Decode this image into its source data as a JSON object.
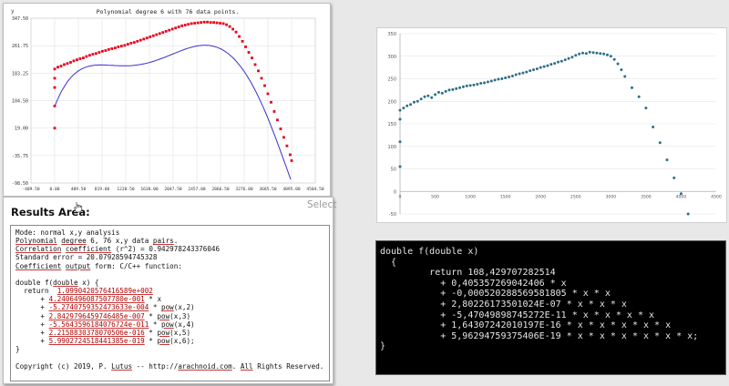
{
  "left_chart": {
    "title": "Polynomial degree 6 with 76 data points.",
    "y_axis_label": "y",
    "y_ticks": [
      "347.50",
      "261.75",
      "183.25",
      "104.50",
      "19.00",
      "-35.75",
      "-98.50"
    ],
    "x_ticks": [
      "-409.50",
      "0.00",
      "409.50",
      "819.00",
      "1228.50",
      "1638.00",
      "2047.50",
      "2457.00",
      "2866.50",
      "3276.00",
      "3685.50",
      "4095.00",
      "4504.50"
    ],
    "point_color": "#e8001c",
    "curve_color": "#3a2fd0"
  },
  "results": {
    "title": "Results Area:",
    "select_label": "Select",
    "lines": {
      "mode": "Mode: normal x,y analysis",
      "poly_a": "Polynomial",
      "poly_b": " ",
      "poly_c": "degree",
      "poly_d": " 6, 76 x,y data ",
      "poly_e": "pairs",
      "poly_f": ".",
      "corr_a": "Correlation",
      "corr_b": " ",
      "corr_c": "coefficient",
      "corr_d": " (r^2) = 0.942978243376046",
      "stderr": "Standard error = 20.07928594745328",
      "coef_a": "Coefficient",
      "coef_b": " ",
      "coef_c": "output",
      "coef_d": " form: C/C++ function:",
      "fn_a": "double f(",
      "fn_b": "double",
      "fn_c": " x) {",
      "ret": "  return  ",
      "c0": "1.0990420576416589e+002",
      "c1": "4.2406496087507780e-001",
      "c1s": " * x",
      "c2": "-5.2740759352473633e-004",
      "c3": "2.8429796459746485e-007",
      "c4": "-5.5643596184076724e-011",
      "c5": "2.2158830378070506e-016",
      "c6": "5.9902724518441385e-019",
      "pow": "pow",
      "p2": "(x,2)",
      "p3": "(x,3)",
      "p4": "(x,4)",
      "p5": "(x,5)",
      "p6": "(x,6);",
      "plus": "      + ",
      "star": " * ",
      "close": "}",
      "copy_a": "Copyright (c) 2019, P. ",
      "copy_b": "Lutus",
      "copy_c": " -- http://",
      "copy_d": "arachnoid.com",
      "copy_e": ". ",
      "copy_f": "All",
      "copy_g": " Rights Reserved."
    }
  },
  "right_chart": {
    "y_ticks": [
      "350",
      "300",
      "250",
      "200",
      "150",
      "100",
      "50",
      "0",
      "-50"
    ],
    "x_ticks": [
      "0",
      "500",
      "1000",
      "1500",
      "2000",
      "2500",
      "3000",
      "3500",
      "4000",
      "4500"
    ],
    "point_color": "#2f6f86"
  },
  "console": {
    "lines": [
      "double f(double x)",
      "  {",
      "         return 108,429707282514",
      "           + 0,405357269042406 * x",
      "           + -0,000520288569581805 * x * x",
      "           + 2,80226173501024E-07 * x * x * x",
      "           + -5,47049898745272E-11 * x * x * x * x",
      "           + 1,64307242010197E-16 * x * x * x * x * x",
      "           + 5,96294759375406E-19 * x * x * x * x * x * x;",
      "}"
    ]
  },
  "chart_data": [
    {
      "type": "scatter",
      "title": "Polynomial degree 6 with 76 data points.",
      "ylabel": "y",
      "xlim": [
        -409.5,
        4504.5
      ],
      "ylim": [
        -98.5,
        347.5
      ],
      "x": [
        0,
        0,
        0,
        0,
        0,
        55,
        110,
        165,
        220,
        275,
        330,
        385,
        440,
        495,
        550,
        605,
        660,
        715,
        770,
        825,
        880,
        935,
        990,
        1045,
        1100,
        1155,
        1210,
        1265,
        1320,
        1375,
        1430,
        1485,
        1540,
        1595,
        1650,
        1705,
        1760,
        1815,
        1870,
        1925,
        1980,
        2035,
        2090,
        2145,
        2200,
        2255,
        2310,
        2365,
        2420,
        2475,
        2530,
        2585,
        2640,
        2695,
        2750,
        2805,
        2860,
        2915,
        2970,
        3025,
        3080,
        3135,
        3190,
        3245,
        3300,
        3355,
        3410,
        3465,
        3520,
        3575,
        3630,
        3685,
        3740,
        3795,
        3850,
        3905,
        3960,
        4015,
        4070,
        4095
      ],
      "series": [
        {
          "values": [
            50,
            110,
            160,
            185,
            210,
            215,
            218,
            222,
            225,
            228,
            232,
            235,
            238,
            240,
            244,
            247,
            250,
            252,
            255,
            258,
            260,
            263,
            265,
            267,
            270,
            272,
            274,
            277,
            280,
            282,
            285,
            288,
            291,
            294,
            297,
            300,
            303,
            306,
            309,
            312,
            315,
            318,
            321,
            324,
            327,
            329,
            331,
            333,
            334,
            335,
            336,
            337,
            337,
            336,
            336,
            335,
            334,
            333,
            330,
            325,
            318,
            310,
            298,
            285,
            270,
            255,
            240,
            222,
            205,
            185,
            165,
            143,
            120,
            95,
            72,
            48,
            25,
            2,
            -22,
            -38
          ]
        }
      ]
    },
    {
      "type": "scatter",
      "xlim": [
        0,
        4500
      ],
      "ylim": [
        -50,
        350
      ],
      "x": [
        0,
        0,
        0,
        0,
        50,
        100,
        150,
        200,
        250,
        300,
        350,
        400,
        450,
        500,
        550,
        600,
        650,
        700,
        750,
        800,
        850,
        900,
        950,
        1000,
        1050,
        1100,
        1150,
        1200,
        1250,
        1300,
        1350,
        1400,
        1450,
        1500,
        1550,
        1600,
        1650,
        1700,
        1750,
        1800,
        1850,
        1900,
        1950,
        2000,
        2050,
        2100,
        2150,
        2200,
        2250,
        2300,
        2350,
        2400,
        2450,
        2500,
        2550,
        2600,
        2650,
        2700,
        2750,
        2800,
        2850,
        2900,
        2950,
        3000,
        3050,
        3100,
        3150,
        3200,
        3300,
        3400,
        3500,
        3600,
        3700,
        3800,
        3900,
        4000,
        4100
      ],
      "series": [
        {
          "values": [
            55,
            110,
            160,
            180,
            185,
            190,
            193,
            198,
            200,
            205,
            210,
            212,
            208,
            215,
            220,
            218,
            222,
            225,
            226,
            228,
            230,
            232,
            234,
            235,
            236,
            238,
            240,
            241,
            243,
            245,
            247,
            249,
            250,
            252,
            254,
            256,
            259,
            261,
            263,
            265,
            268,
            270,
            272,
            275,
            277,
            279,
            282,
            284,
            287,
            289,
            292,
            295,
            298,
            302,
            305,
            307,
            306,
            309,
            308,
            307,
            306,
            305,
            303,
            300,
            293,
            283,
            270,
            255,
            230,
            210,
            185,
            143,
            108,
            70,
            30,
            -5,
            -50
          ]
        }
      ]
    }
  ]
}
